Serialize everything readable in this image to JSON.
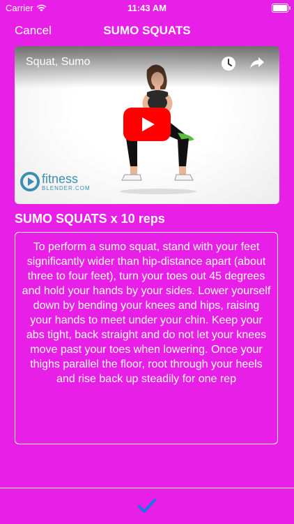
{
  "status_bar": {
    "carrier": "Carrier",
    "time": "11:43 AM"
  },
  "nav": {
    "cancel_label": "Cancel",
    "title": "SUMO SQUATS"
  },
  "video": {
    "title": "Squat, Sumo",
    "brand_name": "fitness",
    "brand_sub": "BLENDER.COM",
    "icons": [
      "watch-later-icon",
      "share-icon",
      "play-icon"
    ]
  },
  "exercise": {
    "heading": "SUMO SQUATS x 10 reps",
    "description": "To perform a sumo squat, stand with your feet significantly wider than hip-distance apart (about three to four feet), turn your toes out 45 degrees and hold your hands by your sides. Lower yourself down by bending your knees and hips, raising your hands to meet under your chin. Keep your abs tight, back straight and do not let your knees move past your toes when lowering. Once your thighs parallel the floor, root through your heels and rise back up steadily for one rep"
  },
  "bottom_bar": {
    "icon": "checkmark-icon"
  },
  "colors": {
    "background": "#e81fe7",
    "accent": "#1a73e8",
    "play_red": "#ff0000"
  }
}
